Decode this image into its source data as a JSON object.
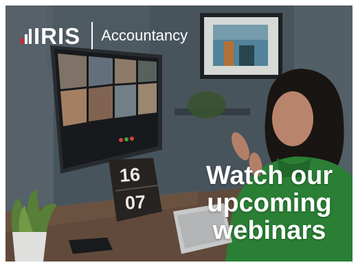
{
  "brand": {
    "name": "IRIS",
    "product": "Accountancy",
    "bar_colors": [
      "#e41f26",
      "#ffffff",
      "#ffffff"
    ]
  },
  "headline": {
    "line1": "Watch our",
    "line2": "upcoming",
    "line3": "webinars"
  },
  "calendar": {
    "top": "16",
    "bottom": "07"
  },
  "colors": {
    "accent_red": "#e41f26",
    "text": "#ffffff",
    "jumper": "#2e8a3a"
  },
  "icons": [
    "logo-bars-icon",
    "plant-icon",
    "monitor-icon",
    "keyboard-icon",
    "phone-icon",
    "framed-picture-icon"
  ]
}
